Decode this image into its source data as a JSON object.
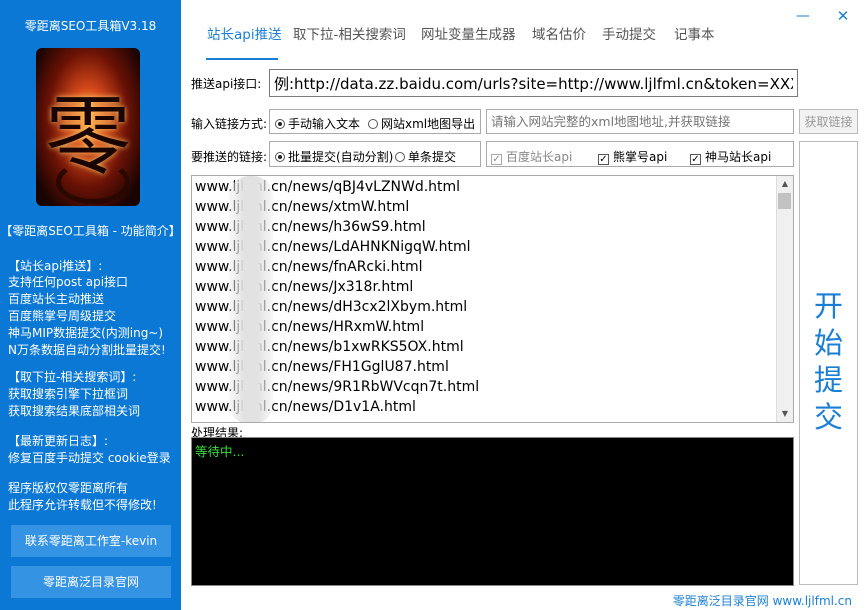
{
  "sidebar": {
    "app_title": "零距离SEO工具箱V3.18",
    "intro_title": "【零距离SEO工具箱 - 功能简介】",
    "section_api": {
      "header": "【站长api推送】:",
      "lines": [
        "支持任何post api接口",
        "百度站长主动推送",
        "百度熊掌号周级提交",
        "神马MIP数据提交(内测ing~)",
        "N万条数据自动分割批量提交!"
      ]
    },
    "section_dropdown": {
      "header": "【取下拉-相关搜索词】:",
      "lines": [
        "获取搜索引擎下拉框词",
        "获取搜索结果底部相关词"
      ]
    },
    "section_log": {
      "header": "【最新更新日志】:",
      "lines": [
        "修复百度手动提交 cookie登录"
      ]
    },
    "copyright": [
      "程序版权仅零距离所有",
      "此程序允许转载但不得修改!"
    ],
    "btn_contact": "联系零距离工作室-kevin",
    "btn_website": "零距离泛目录官网"
  },
  "tabs": [
    {
      "label": "站长api推送",
      "active": true
    },
    {
      "label": "取下拉-相关搜索词",
      "active": false
    },
    {
      "label": "网址变量生成器",
      "active": false
    },
    {
      "label": "域名估价",
      "active": false
    },
    {
      "label": "手动提交",
      "active": false
    },
    {
      "label": "记事本",
      "active": false
    }
  ],
  "window": {
    "minimize": "—",
    "close": "✕"
  },
  "form": {
    "api_label": "推送api接口:",
    "api_value": "例:http://data.zz.baidu.com/urls?site=http://www.ljlfml.cn&token=XXXXXXXX",
    "input_mode_label": "输入链接方式:",
    "input_modes": [
      {
        "label": "手动输入文本",
        "selected": true
      },
      {
        "label": "网站xml地图导出",
        "selected": false
      }
    ],
    "xml_placeholder": "请输入网站完整的xml地图地址,并获取链接",
    "fetch_button": "获取链接",
    "push_mode_label": "要推送的链接:",
    "push_modes": [
      {
        "label": "批量提交(自动分割)",
        "selected": true
      },
      {
        "label": "单条提交",
        "selected": false
      }
    ],
    "targets": [
      {
        "label": "百度站长api",
        "checked": true,
        "enabled": false
      },
      {
        "label": "熊掌号api",
        "checked": true,
        "enabled": true
      },
      {
        "label": "神马站长api",
        "checked": true,
        "enabled": true
      }
    ]
  },
  "links": [
    "www.ljlfml.cn/news/qBJ4vLZNWd.html",
    "www.ljlfml.cn/news/xtmW.html",
    "www.ljlfml.cn/news/h36wS9.html",
    "www.ljlfml.cn/news/LdAHNKNigqW.html",
    "www.ljlfml.cn/news/fnARcki.html",
    "www.ljlfml.cn/news/Jx318r.html",
    "www.ljlfml.cn/news/dH3cx2lXbym.html",
    "www.ljlfml.cn/news/HRxmW.html",
    "www.ljlfml.cn/news/b1xwRKS5OX.html",
    "www.ljlfml.cn/news/FH1GglU87.html",
    "www.ljlfml.cn/news/9R1RbWVcqn7t.html",
    "www.ljlfml.cn/news/D1v1A.html"
  ],
  "result": {
    "label": "处理结果:",
    "text": "等待中..."
  },
  "start_button": [
    "开",
    "始",
    "提",
    "交"
  ],
  "footer": "零距离泛目录官网 www.ljlfml.cn",
  "colors": {
    "sidebar_bg": "#0a78d4",
    "accent": "#1a7fd4",
    "console_text": "#3ddc3d"
  }
}
